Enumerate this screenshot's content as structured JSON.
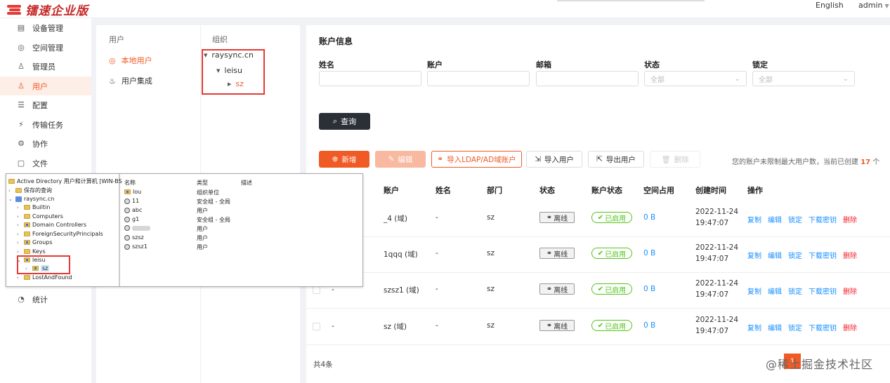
{
  "header": {
    "logo_text": "镭速企业版",
    "language": "English",
    "user": "admin"
  },
  "sidebar": {
    "items": [
      {
        "label": "设备管理",
        "icon": "device-icon",
        "glyph": "▤"
      },
      {
        "label": "空间管理",
        "icon": "space-icon",
        "glyph": "◎"
      },
      {
        "label": "管理员",
        "icon": "admin-icon",
        "glyph": "♙"
      },
      {
        "label": "用户",
        "icon": "user-icon",
        "glyph": "♙"
      },
      {
        "label": "配置",
        "icon": "config-icon",
        "glyph": "☰"
      },
      {
        "label": "传输任务",
        "icon": "transfer-icon",
        "glyph": "⚡"
      },
      {
        "label": "协作",
        "icon": "collab-icon",
        "glyph": "⚙"
      },
      {
        "label": "文件",
        "icon": "file-icon",
        "glyph": "▢"
      },
      {
        "label": "统计",
        "icon": "stats-icon",
        "glyph": "◔"
      }
    ],
    "active_index": 3
  },
  "users_panel": {
    "header": "用户",
    "items": [
      "本地用户",
      "用户集成"
    ]
  },
  "org_panel": {
    "header": "组织",
    "root": "raysync.cn",
    "child": "leisu",
    "grandchild": "sz"
  },
  "main": {
    "title": "账户信息",
    "filters": {
      "name_label": "姓名",
      "account_label": "账户",
      "email_label": "邮箱",
      "status_label": "状态",
      "status_value": "全部",
      "lock_label": "锁定",
      "lock_value": "全部"
    },
    "query_button": "查询",
    "toolbar": {
      "add": "新增",
      "edit": "编辑",
      "import_ldap": "导入LDAP/AD域账户",
      "import_users": "导入用户",
      "export_users": "导出用户",
      "delete": "删除"
    },
    "notice_prefix": "您的账户未限制最大用户数，当前已创建",
    "notice_count": "17",
    "notice_suffix": "个",
    "columns": [
      "账户",
      "姓名",
      "部门",
      "状态",
      "账户状态",
      "空间占用",
      "创建时间",
      "操作"
    ],
    "rows": [
      {
        "id": "",
        "account": "_4 (域)",
        "name": "-",
        "dept": "sz",
        "status": "离线",
        "acct_status": "已启用",
        "space": "0 B",
        "created_date": "2022-11-24",
        "created_time": "19:47:07"
      },
      {
        "id": "",
        "account": "1qqq (域)",
        "name": "-",
        "dept": "sz",
        "status": "离线",
        "acct_status": "已启用",
        "space": "0 B",
        "created_date": "2022-11-24",
        "created_time": "19:47:07"
      },
      {
        "id": "-",
        "account": "szsz1 (域)",
        "name": "-",
        "dept": "sz",
        "status": "离线",
        "acct_status": "已启用",
        "space": "0 B",
        "created_date": "2022-11-24",
        "created_time": "19:47:07"
      },
      {
        "id": "-",
        "account": "sz (域)",
        "name": "-",
        "dept": "sz",
        "status": "离线",
        "acct_status": "已启用",
        "space": "0 B",
        "created_date": "2022-11-24",
        "created_time": "19:47:07"
      }
    ],
    "row_ops": [
      "复制",
      "编辑",
      "锁定",
      "下载密钥",
      "删除"
    ],
    "total": "共4条"
  },
  "watermark": "@稀土掘金技术社区",
  "ad_window": {
    "title": "Active Directory 用户和计算机 [WIN-BS",
    "saved_queries": "保存的查询",
    "domain": "raysync.cn",
    "tree": [
      "Builtin",
      "Computers",
      "Domain Controllers",
      "ForeignSecurityPrincipals",
      "Groups",
      "Keys",
      "leisu",
      "sz",
      "LostAndFound"
    ],
    "headers": [
      "名称",
      "类型",
      "描述"
    ],
    "entries": [
      {
        "name": "lou",
        "type": "组织单位"
      },
      {
        "name": "11",
        "type": "安全组 - 全局"
      },
      {
        "name": "abc",
        "type": "用户"
      },
      {
        "name": "g1",
        "type": "安全组 - 全局"
      },
      {
        "name": "",
        "type": "用户"
      },
      {
        "name": "szsz",
        "type": "用户"
      },
      {
        "name": "szsz1",
        "type": "用户"
      }
    ]
  }
}
